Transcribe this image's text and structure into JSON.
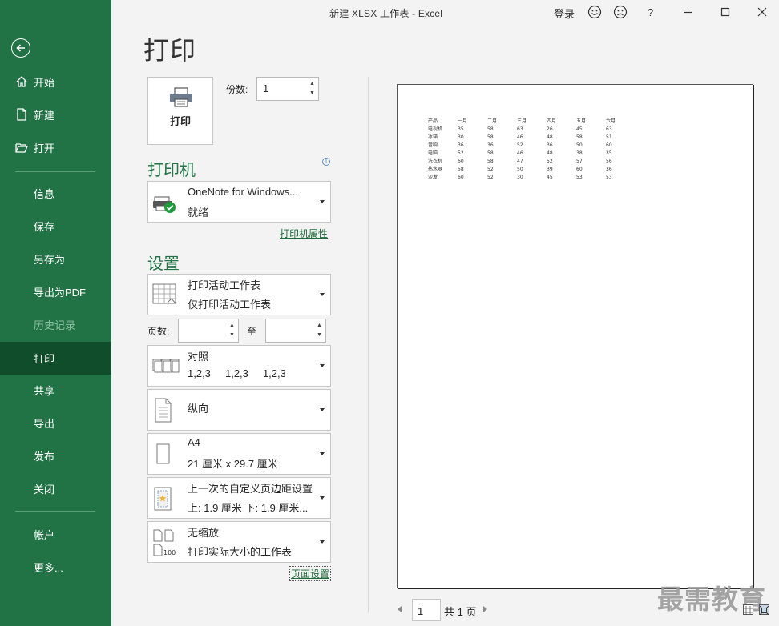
{
  "window": {
    "title": "新建 XLSX 工作表  -  Excel",
    "login_label": "登录",
    "help_label": "?",
    "icons": [
      "smile-icon",
      "frown-icon",
      "help-icon",
      "minimize-icon",
      "maximize-icon",
      "close-icon"
    ]
  },
  "sidebar": {
    "back_icon": "back-arrow-icon",
    "items": [
      {
        "label": "开始",
        "icon": "home-icon"
      },
      {
        "label": "新建",
        "icon": "new-file-icon"
      },
      {
        "label": "打开",
        "icon": "open-folder-icon"
      },
      {
        "label": "信息"
      },
      {
        "label": "保存"
      },
      {
        "label": "另存为"
      },
      {
        "label": "导出为PDF"
      },
      {
        "label": "历史记录",
        "disabled": true
      },
      {
        "label": "打印",
        "active": true
      },
      {
        "label": "共享"
      },
      {
        "label": "导出"
      },
      {
        "label": "发布"
      },
      {
        "label": "关闭"
      },
      {
        "label": "帐户"
      },
      {
        "label": "更多..."
      }
    ],
    "colors": {
      "background": "#217346",
      "active": "#0f4d2b"
    }
  },
  "print": {
    "page_title": "打印",
    "print_button_label": "打印",
    "copies_label": "份数:",
    "copies_value": "1",
    "printer_heading": "打印机",
    "printer_name": "OneNote for Windows...",
    "printer_status": "就绪",
    "printer_properties_link": "打印机属性",
    "settings_heading": "设置",
    "settings": [
      {
        "title": "打印活动工作表",
        "subtitle": "仅打印活动工作表",
        "icon": "worksheet-icon"
      },
      {
        "title": "对照",
        "subtitle": "1,2,3     1,2,3     1,2,3",
        "icon": "collate-icon"
      },
      {
        "title": "纵向",
        "subtitle": "",
        "icon": "portrait-icon"
      },
      {
        "title": "A4",
        "subtitle": "21 厘米 x 29.7 厘米",
        "icon": "paper-size-icon"
      },
      {
        "title": "上一次的自定义页边距设置",
        "subtitle": "上: 1.9 厘米 下: 1.9 厘米...",
        "icon": "margins-icon"
      },
      {
        "title": "无缩放",
        "subtitle": "打印实际大小的工作表",
        "icon": "no-scaling-icon"
      }
    ],
    "pages_label": "页数:",
    "pages_to_label": "至",
    "page_setup_link": "页面设置",
    "accent_color": "#217346"
  },
  "preview": {
    "table": [
      [
        "产品",
        "一月",
        "二月",
        "三月",
        "四月",
        "五月",
        "六月"
      ],
      [
        "电视机",
        "35",
        "58",
        "63",
        "26",
        "45",
        "63"
      ],
      [
        "冰箱",
        "30",
        "58",
        "46",
        "48",
        "58",
        "51"
      ],
      [
        "音响",
        "36",
        "36",
        "52",
        "36",
        "50",
        "60"
      ],
      [
        "电脑",
        "52",
        "58",
        "46",
        "48",
        "38",
        "35"
      ],
      [
        "洗衣机",
        "60",
        "58",
        "47",
        "52",
        "57",
        "56"
      ],
      [
        "热水器",
        "58",
        "52",
        "50",
        "39",
        "60",
        "36"
      ],
      [
        "沙发",
        "60",
        "52",
        "30",
        "45",
        "53",
        "53"
      ]
    ],
    "current_page": "1",
    "total_pages": "共 1 页"
  },
  "watermark": "最需教育"
}
